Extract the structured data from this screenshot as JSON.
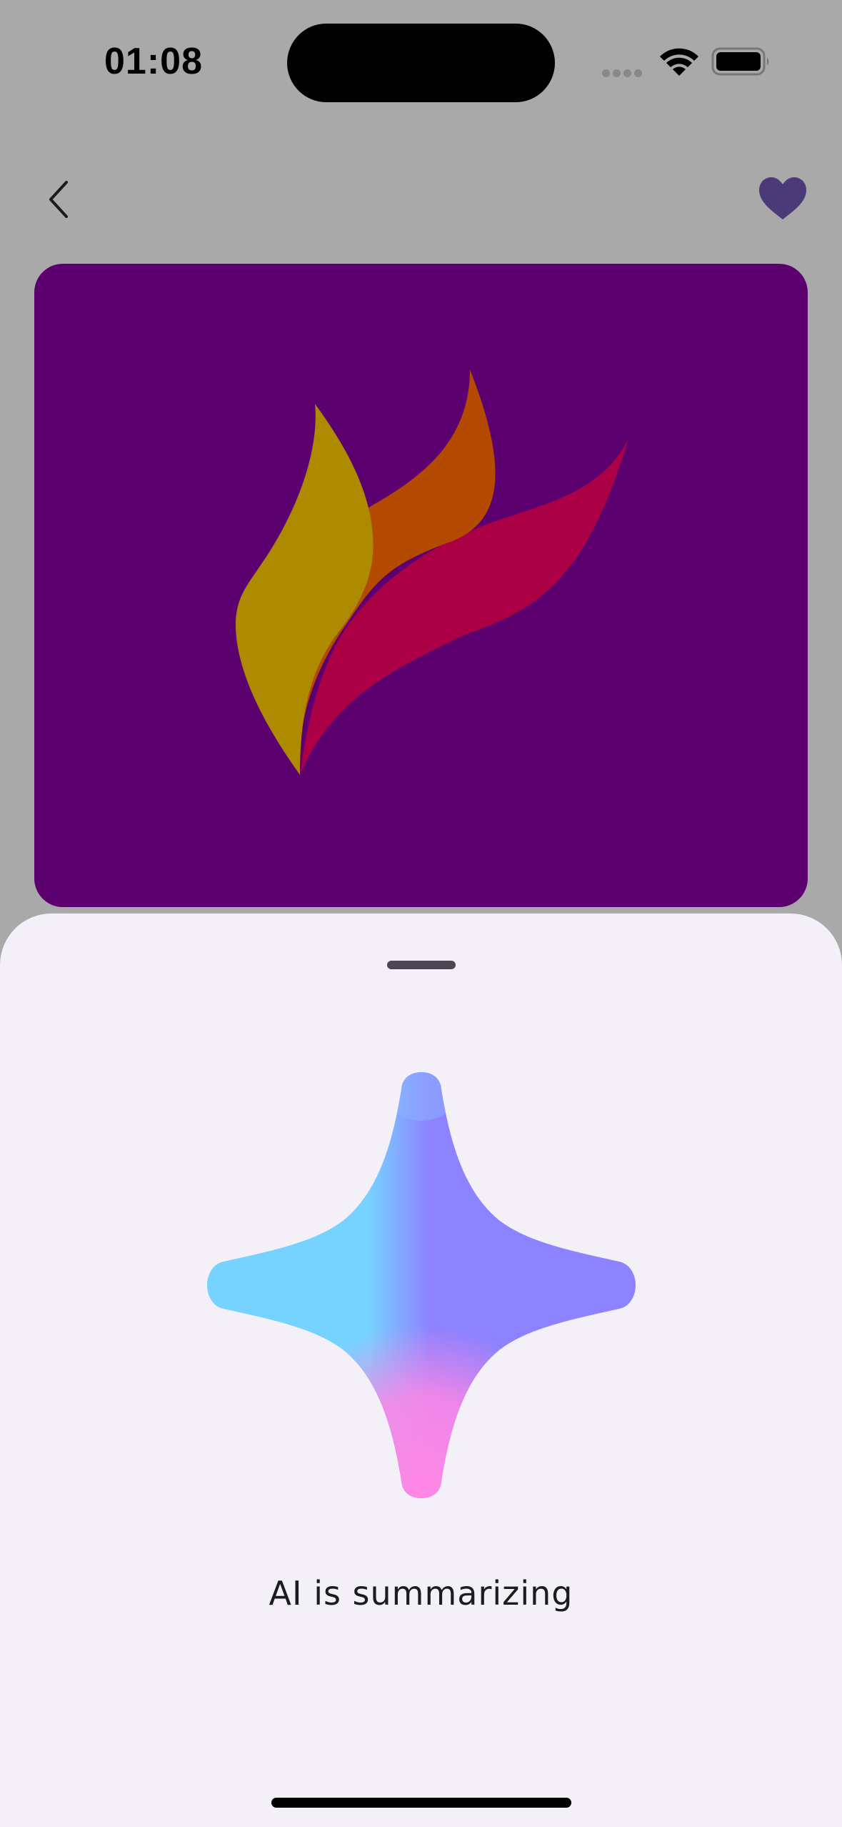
{
  "status_bar": {
    "time": "01:08",
    "wifi_icon": "wifi-icon",
    "battery_icon": "battery-icon"
  },
  "nav": {
    "back_icon": "chevron-left-icon",
    "favorite_icon": "heart-icon",
    "favorite_color": "#4a3a78"
  },
  "hero": {
    "background_color": "#5c0070",
    "logo_icon": "flame-petals-logo",
    "logo_colors": [
      "#ad8a00",
      "#b34a00",
      "#ab0045"
    ]
  },
  "sheet": {
    "background_color": "#f4f0f8",
    "sparkle_icon": "ai-sparkle-icon",
    "sparkle_colors": [
      "#76d2ff",
      "#8d82ff",
      "#ff87e5"
    ],
    "status_text": "AI is summarizing"
  }
}
